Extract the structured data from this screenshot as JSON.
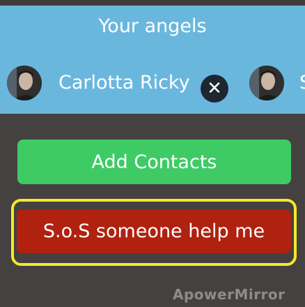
{
  "header": {
    "title": "Your angels"
  },
  "contacts": [
    {
      "name": "Carlotta Ricky"
    },
    {
      "name": "S"
    }
  ],
  "buttons": {
    "add_contacts": "Add Contacts",
    "sos": "S.o.S someone help me"
  },
  "watermark": "ApowerMirror",
  "colors": {
    "panel": "#6ab7de",
    "add_button": "#3ecb66",
    "sos_button": "#b1210f",
    "highlight": "#f3ea27",
    "background": "#454140"
  }
}
